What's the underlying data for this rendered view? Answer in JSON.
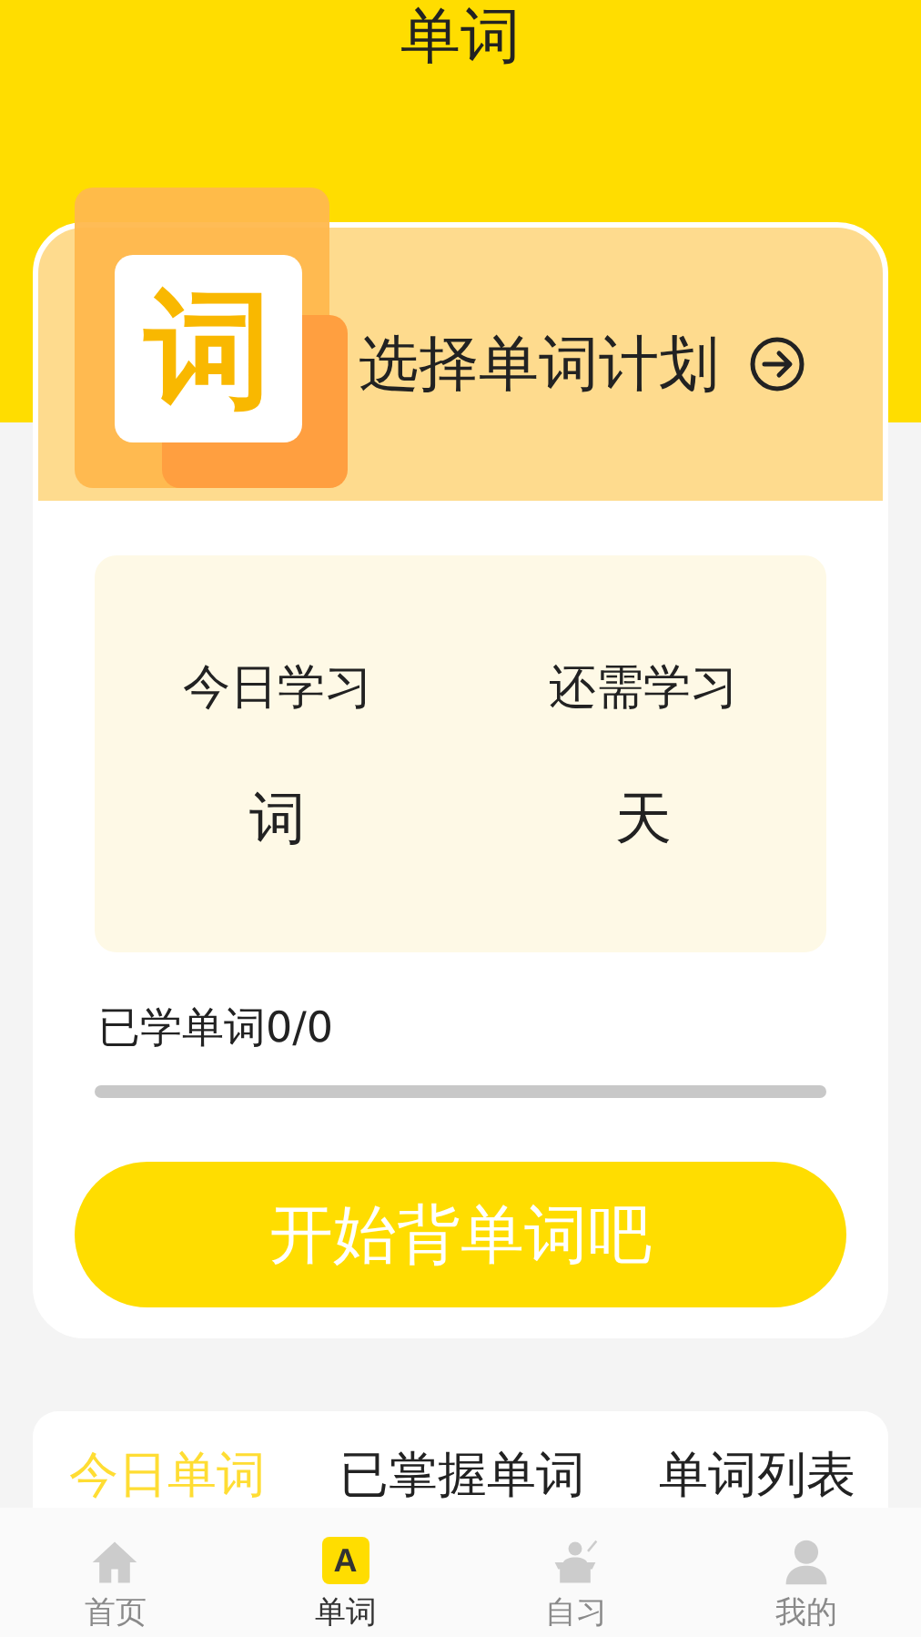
{
  "header": {
    "title": "单词"
  },
  "plan": {
    "icon_glyph": "词",
    "text": "选择单词计划"
  },
  "stats": [
    {
      "label": "今日学习",
      "value": "词"
    },
    {
      "label": "还需学习",
      "value": "天"
    }
  ],
  "progress": {
    "label": "已学单词0/0",
    "level": 0
  },
  "start_button": "开始背单词吧",
  "tabs": [
    {
      "label": "今日单词",
      "selected": true
    },
    {
      "label": "已掌握单词",
      "selected": false
    },
    {
      "label": "单词列表",
      "selected": false
    }
  ],
  "nav": [
    {
      "kind": "home",
      "label": "首页",
      "selected": false
    },
    {
      "kind": "words",
      "label": "单词",
      "glyph": "A",
      "selected": true
    },
    {
      "kind": "study",
      "label": "自习",
      "selected": false
    },
    {
      "kind": "me",
      "label": "我的",
      "selected": false
    }
  ]
}
